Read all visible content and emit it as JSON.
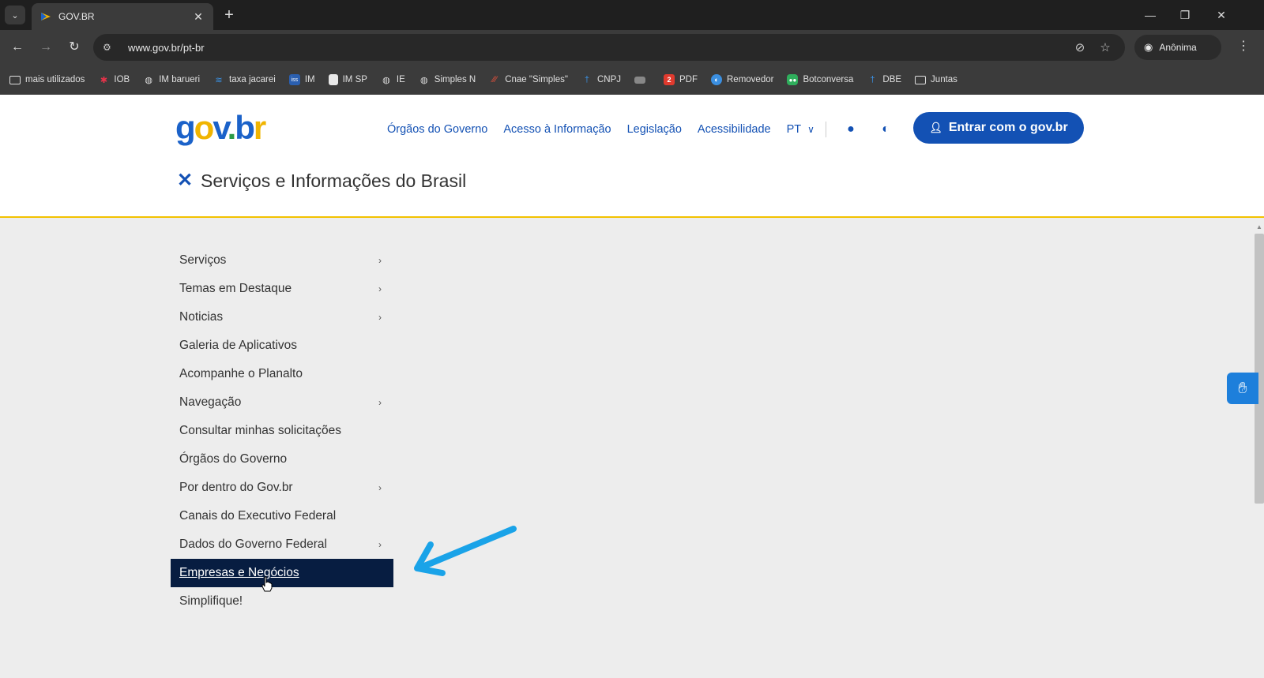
{
  "browser": {
    "tab": {
      "title": "GOV.BR",
      "close": "✕"
    },
    "new_tab": "+",
    "url": "www.gov.br/pt-br",
    "profile": "Anônima",
    "bookmarks": [
      {
        "label": "mais utilizados",
        "icon": "folder-icon"
      },
      {
        "label": "IOB",
        "icon": "star-icon"
      },
      {
        "label": "IM barueri",
        "icon": "globe-icon"
      },
      {
        "label": "taxa jacarei",
        "icon": "wave-icon"
      },
      {
        "label": "IM",
        "icon": "iss-icon"
      },
      {
        "label": "IM SP",
        "icon": "doc-icon"
      },
      {
        "label": "IE",
        "icon": "globe-icon"
      },
      {
        "label": "Simples N",
        "icon": "globe-icon"
      },
      {
        "label": "Cnae \"Simples\"",
        "icon": "stripes-icon"
      },
      {
        "label": "CNPJ",
        "icon": "dagger-icon"
      },
      {
        "label": "",
        "icon": "flag-icon"
      },
      {
        "label": "PDF",
        "icon": "pdf-icon"
      },
      {
        "label": "Removedor",
        "icon": "remover-icon"
      },
      {
        "label": "Botconversa",
        "icon": "bot-icon"
      },
      {
        "label": "DBE",
        "icon": "dagger-icon"
      },
      {
        "label": "Juntas",
        "icon": "folder-icon"
      }
    ]
  },
  "header": {
    "logo": {
      "g": "g",
      "o": "o",
      "v": "v",
      "dot": ".",
      "b": "b",
      "r": "r"
    },
    "links": [
      "Órgãos do Governo",
      "Acesso à Informação",
      "Legislação",
      "Acessibilidade"
    ],
    "language": "PT",
    "login_label": "Entrar com o gov.br",
    "title": "Serviços e Informações do Brasil"
  },
  "menu": {
    "items": [
      {
        "label": "Serviços",
        "submenu": true
      },
      {
        "label": "Temas em Destaque",
        "submenu": true
      },
      {
        "label": "Noticias",
        "submenu": true
      },
      {
        "label": "Galeria de Aplicativos",
        "submenu": false
      },
      {
        "label": "Acompanhe o Planalto",
        "submenu": false
      },
      {
        "label": "Navegação",
        "submenu": true
      },
      {
        "label": "Consultar minhas solicitações",
        "submenu": false
      },
      {
        "label": "Órgãos do Governo",
        "submenu": false
      },
      {
        "label": "Por dentro do Gov.br",
        "submenu": true
      },
      {
        "label": "Canais do Executivo Federal",
        "submenu": false
      },
      {
        "label": "Dados do Governo Federal",
        "submenu": true
      },
      {
        "label": "Empresas e Negócios",
        "submenu": false,
        "active": true
      },
      {
        "label": "Simplifique!",
        "submenu": false
      }
    ]
  },
  "colors": {
    "primary": "#1351b4",
    "active_bg": "#071d41",
    "accent_line": "#f2c200",
    "annotation": "#1aa3e8"
  }
}
